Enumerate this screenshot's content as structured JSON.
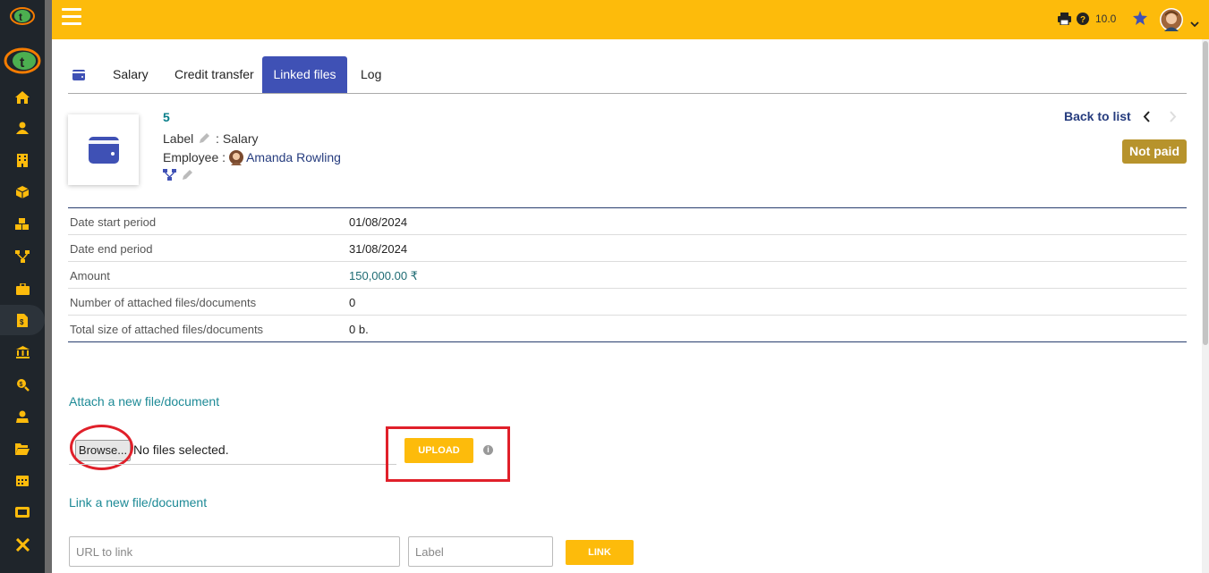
{
  "topbar": {
    "version": "10.0"
  },
  "tabs": [
    {
      "label": ""
    },
    {
      "label": "Salary"
    },
    {
      "label": "Credit transfer"
    },
    {
      "label": "Linked files"
    },
    {
      "label": "Log"
    }
  ],
  "record": {
    "ref": "5",
    "label_caption": "Label",
    "label_value": ": Salary",
    "employee_caption": "Employee :",
    "employee_name": "Amanda Rowling",
    "back_to_list": "Back to list",
    "status": "Not paid"
  },
  "fields": [
    {
      "label": "Date start period",
      "value": "01/08/2024"
    },
    {
      "label": "Date end period",
      "value": "31/08/2024"
    },
    {
      "label": "Amount",
      "value": "150,000.00 ₹"
    },
    {
      "label": "Number of attached files/documents",
      "value": "0"
    },
    {
      "label": "Total size of attached files/documents",
      "value": "0 b."
    }
  ],
  "attach": {
    "title": "Attach a new file/document",
    "browse_label": "Browse...",
    "no_files": "No files selected.",
    "upload_label": "UPLOAD",
    "info": "i"
  },
  "link": {
    "title": "Link a new file/document",
    "url_placeholder": "URL to link",
    "label_placeholder": "Label",
    "link_label": "LINK"
  },
  "colors": {
    "topbar": "#fdbb0b",
    "sidebar": "#1f252b",
    "accent": "#3f51b5",
    "highlight": "#e0202a"
  }
}
